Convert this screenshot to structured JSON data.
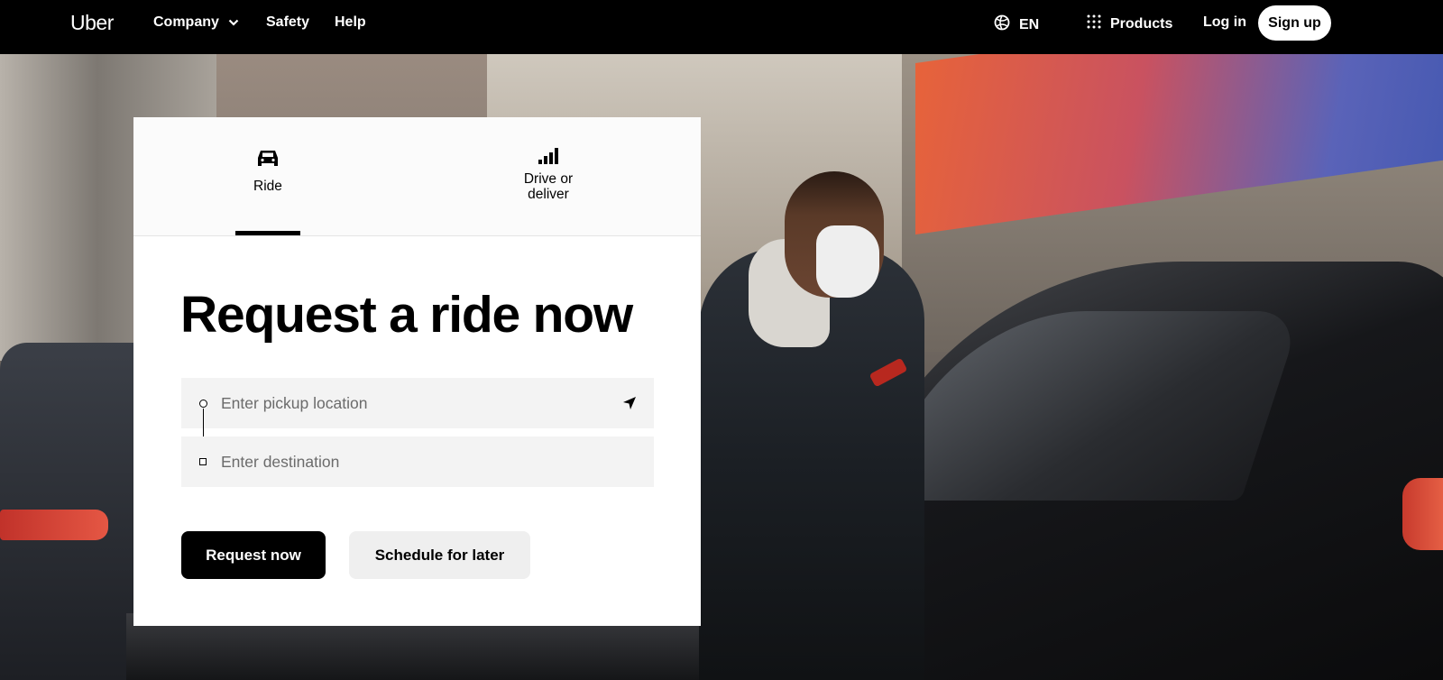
{
  "nav": {
    "logo": "Uber",
    "links": [
      {
        "label": "Company"
      },
      {
        "label": "Safety"
      },
      {
        "label": "Help"
      }
    ],
    "language": "EN",
    "products": "Products",
    "login": "Log in",
    "signup": "Sign up"
  },
  "card": {
    "tabs": [
      {
        "label": "Ride",
        "icon": "car-icon",
        "selected": true
      },
      {
        "label": "Drive or deliver",
        "icon": "bar-signal-icon",
        "selected": false
      }
    ],
    "title": "Request a ride now",
    "pickup": {
      "placeholder": "Enter pickup location",
      "value": ""
    },
    "destination": {
      "placeholder": "Enter destination",
      "value": ""
    },
    "request_button": "Request now",
    "schedule_button": "Schedule for later"
  },
  "colors": {
    "nav_background": "#000000",
    "primary_button": "#000000",
    "input_background": "#f3f3f3",
    "secondary_button": "#efefef"
  }
}
